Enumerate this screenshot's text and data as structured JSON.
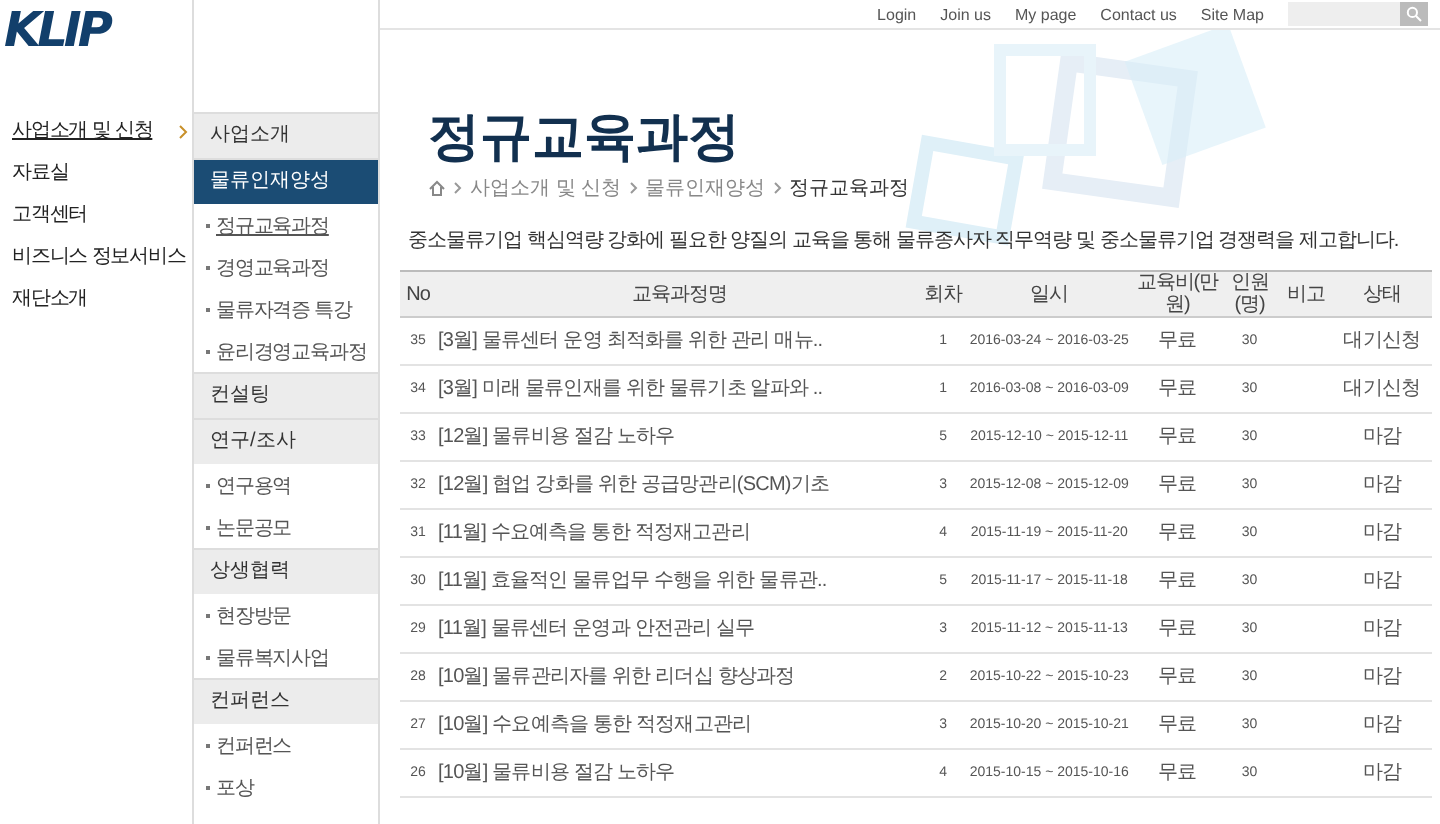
{
  "logo": {
    "text": "KLIP"
  },
  "top_links": [
    "Login",
    "Join us",
    "My page",
    "Contact us",
    "Site Map"
  ],
  "nav": [
    {
      "label": "사업소개 및 신청",
      "selected": true
    },
    {
      "label": "자료실",
      "selected": false
    },
    {
      "label": "고객센터",
      "selected": false
    },
    {
      "label": "비즈니스 정보서비스",
      "selected": false
    },
    {
      "label": "재단소개",
      "selected": false
    }
  ],
  "submenu": [
    {
      "label": "사업소개",
      "selected": false
    },
    {
      "label": "물류인재양성",
      "selected": true,
      "children": [
        {
          "label": "정규교육과정",
          "selected": true
        },
        {
          "label": "경영교육과정",
          "selected": false
        },
        {
          "label": "물류자격증 특강",
          "selected": false
        },
        {
          "label": "윤리경영교육과정",
          "selected": false
        }
      ]
    },
    {
      "label": "컨설팅",
      "selected": false
    },
    {
      "label": "연구/조사",
      "selected": false,
      "children": [
        {
          "label": "연구용역",
          "selected": false
        },
        {
          "label": "논문공모",
          "selected": false
        }
      ]
    },
    {
      "label": "상생협력",
      "selected": false,
      "children": [
        {
          "label": "현장방문",
          "selected": false
        },
        {
          "label": "물류복지사업",
          "selected": false
        }
      ]
    },
    {
      "label": "컨퍼런스",
      "selected": false,
      "children": [
        {
          "label": "컨퍼런스",
          "selected": false
        },
        {
          "label": "포상",
          "selected": false
        }
      ]
    }
  ],
  "page_title": "정규교육과정",
  "breadcrumb": [
    "사업소개 및 신청",
    "물류인재양성",
    "정규교육과정"
  ],
  "description": "중소물류기업 핵심역량 강화에 필요한 양질의 교육을 통해 물류종사자 직무역량 및 중소물류기업 경쟁력을 제고합니다.",
  "table": {
    "columns": [
      "No",
      "교육과정명",
      "회차",
      "일시",
      "교육비(만원)",
      "인원(명)",
      "비고",
      "상태"
    ],
    "rows": [
      [
        "35",
        "[3월] 물류센터 운영 최적화를 위한 관리 매뉴..",
        "1",
        "2016-03-24 ~ 2016-03-25",
        "무료",
        "30",
        "",
        "대기신청"
      ],
      [
        "34",
        "[3월] 미래 물류인재를 위한 물류기초 알파와 ..",
        "1",
        "2016-03-08 ~ 2016-03-09",
        "무료",
        "30",
        "",
        "대기신청"
      ],
      [
        "33",
        "[12월] 물류비용 절감 노하우",
        "5",
        "2015-12-10 ~ 2015-12-11",
        "무료",
        "30",
        "",
        "마감"
      ],
      [
        "32",
        "[12월] 협업 강화를 위한 공급망관리(SCM)기초",
        "3",
        "2015-12-08 ~ 2015-12-09",
        "무료",
        "30",
        "",
        "마감"
      ],
      [
        "31",
        "[11월] 수요예측을 통한 적정재고관리",
        "4",
        "2015-11-19 ~ 2015-11-20",
        "무료",
        "30",
        "",
        "마감"
      ],
      [
        "30",
        "[11월] 효율적인 물류업무 수행을 위한 물류관..",
        "5",
        "2015-11-17 ~ 2015-11-18",
        "무료",
        "30",
        "",
        "마감"
      ],
      [
        "29",
        "[11월] 물류센터 운영과 안전관리 실무",
        "3",
        "2015-11-12 ~ 2015-11-13",
        "무료",
        "30",
        "",
        "마감"
      ],
      [
        "28",
        "[10월] 물류관리자를 위한 리더십 향상과정",
        "2",
        "2015-10-22 ~ 2015-10-23",
        "무료",
        "30",
        "",
        "마감"
      ],
      [
        "27",
        "[10월] 수요예측을 통한 적정재고관리",
        "3",
        "2015-10-20 ~ 2015-10-21",
        "무료",
        "30",
        "",
        "마감"
      ],
      [
        "26",
        "[10월] 물류비용 절감 노하우",
        "4",
        "2015-10-15 ~ 2015-10-16",
        "무료",
        "30",
        "",
        "마감"
      ]
    ]
  }
}
